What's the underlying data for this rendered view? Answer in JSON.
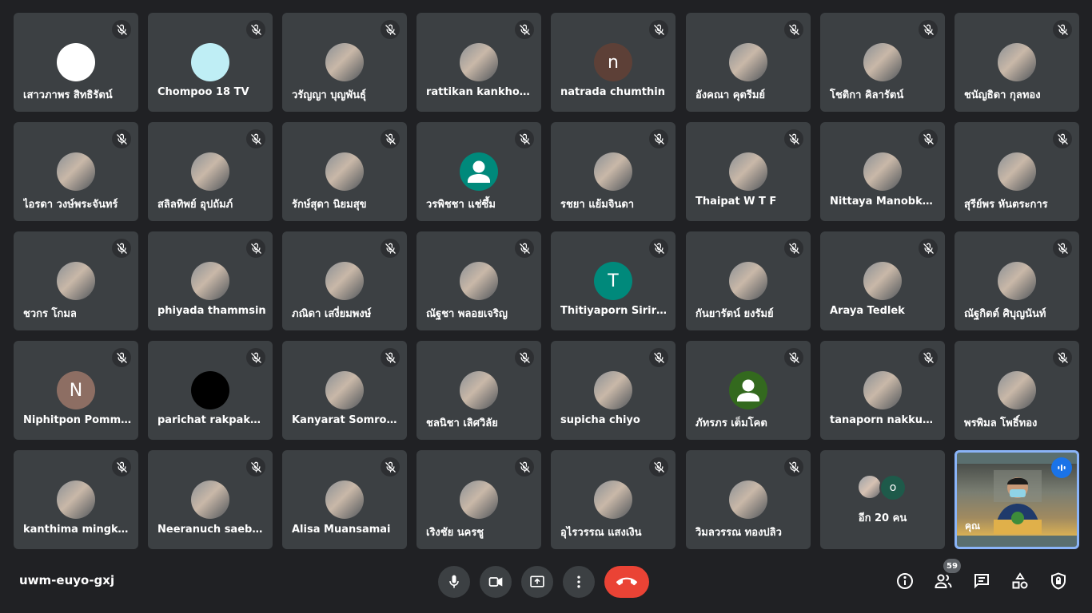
{
  "meeting": {
    "code": "uwm-euyo-gxj"
  },
  "participants": [
    {
      "name": "เสาวภาพร สิทธิรัตน์",
      "avatar": {
        "type": "photo",
        "bg": "#ffffff"
      }
    },
    {
      "name": "Chompoo 18 TV",
      "avatar": {
        "type": "photo",
        "bg": "#bfeef5"
      }
    },
    {
      "name": "วรัญญา บุญพันธุ์",
      "avatar": {
        "type": "photo"
      }
    },
    {
      "name": "rattikan kankhodcharoen",
      "avatar": {
        "type": "photo"
      }
    },
    {
      "name": "natrada chumthin",
      "avatar": {
        "type": "letter",
        "letter": "n",
        "bg": "#5d4037"
      }
    },
    {
      "name": "อังคณา คุตรีมย์",
      "avatar": {
        "type": "photo"
      }
    },
    {
      "name": "โชติกา คิลารัตน์",
      "avatar": {
        "type": "photo"
      }
    },
    {
      "name": "ชนัญธิดา กุลทอง",
      "avatar": {
        "type": "photo"
      }
    },
    {
      "name": "ไอรดา วงษ์พระจันทร์",
      "avatar": {
        "type": "photo"
      }
    },
    {
      "name": "สลิลทิพย์ อุปถัมภ์",
      "avatar": {
        "type": "photo"
      }
    },
    {
      "name": "รักษ์สุดา นิยมสุข",
      "avatar": {
        "type": "photo"
      }
    },
    {
      "name": "วรพิชชา แช่ซึ้ม",
      "avatar": {
        "type": "default",
        "bg": "#00897b"
      }
    },
    {
      "name": "รชยา แย้มจินดา",
      "avatar": {
        "type": "photo"
      }
    },
    {
      "name": "Thaipat W T F",
      "avatar": {
        "type": "photo"
      }
    },
    {
      "name": "Nittaya Manobkham",
      "avatar": {
        "type": "photo"
      }
    },
    {
      "name": "สุรีย์พร หันตระการ",
      "avatar": {
        "type": "photo"
      }
    },
    {
      "name": "ชวกร โกมล",
      "avatar": {
        "type": "photo"
      }
    },
    {
      "name": "phiyada thammsin",
      "avatar": {
        "type": "photo"
      }
    },
    {
      "name": "ภณิดา เสงี่ยมพงษ์",
      "avatar": {
        "type": "photo"
      }
    },
    {
      "name": "ณัฐชา พลอยเจริญ",
      "avatar": {
        "type": "photo"
      }
    },
    {
      "name": "Thitiyaporn Sirirak",
      "avatar": {
        "type": "letter",
        "letter": "T",
        "bg": "#00897b"
      }
    },
    {
      "name": "กันยารัตน์ ยงรัมย์",
      "avatar": {
        "type": "photo"
      }
    },
    {
      "name": "Araya Tedlek",
      "avatar": {
        "type": "photo"
      }
    },
    {
      "name": "ณัฐกิตต์ ศิบุญนันท์",
      "avatar": {
        "type": "photo"
      }
    },
    {
      "name": "Niphitpon Pommongkol",
      "avatar": {
        "type": "letter",
        "letter": "N",
        "bg": "#8d6e63"
      }
    },
    {
      "name": "parichat rakpakdee",
      "avatar": {
        "type": "photo",
        "bg": "#000000"
      }
    },
    {
      "name": "Kanyarat Somrong",
      "avatar": {
        "type": "photo"
      }
    },
    {
      "name": "ชลนิชา เลิศวิลัย",
      "avatar": {
        "type": "photo"
      }
    },
    {
      "name": "supicha chiyo",
      "avatar": {
        "type": "photo"
      }
    },
    {
      "name": "ภัทรภร เต็มโคต",
      "avatar": {
        "type": "default",
        "bg": "#33691e"
      }
    },
    {
      "name": "tanaporn nakkunla",
      "avatar": {
        "type": "photo"
      }
    },
    {
      "name": "พรพิมล โพธิ์ทอง",
      "avatar": {
        "type": "photo"
      }
    },
    {
      "name": "kanthima mingkeaw",
      "avatar": {
        "type": "photo"
      }
    },
    {
      "name": "Neeranuch saebang",
      "avatar": {
        "type": "photo"
      }
    },
    {
      "name": "Alisa Muansamai",
      "avatar": {
        "type": "photo"
      }
    },
    {
      "name": "เริงชัย นครชู",
      "avatar": {
        "type": "photo"
      }
    },
    {
      "name": "อุไรวรรณ แสงเงิน",
      "avatar": {
        "type": "photo"
      }
    },
    {
      "name": "วิมลวรรณ ทองปลิว",
      "avatar": {
        "type": "photo"
      }
    }
  ],
  "others_tile": {
    "label": "อีก 20 คน",
    "letter": "o"
  },
  "self_tile": {
    "name": "คุณ"
  },
  "controls": {
    "participants_count": "59"
  },
  "icons": {
    "mic_off": "mic-off-icon",
    "mic": "mic-icon",
    "camera": "camera-icon",
    "present": "present-screen-icon",
    "more": "more-options-icon",
    "end_call": "end-call-icon",
    "info": "info-icon",
    "people": "people-icon",
    "chat": "chat-icon",
    "activities": "activities-icon",
    "host_controls": "host-controls-icon"
  },
  "colors": {
    "background": "#202124",
    "tile": "#3c4043",
    "end_call": "#ea4335",
    "active_border": "#8ab4f8",
    "speaking": "#1a73e8"
  }
}
